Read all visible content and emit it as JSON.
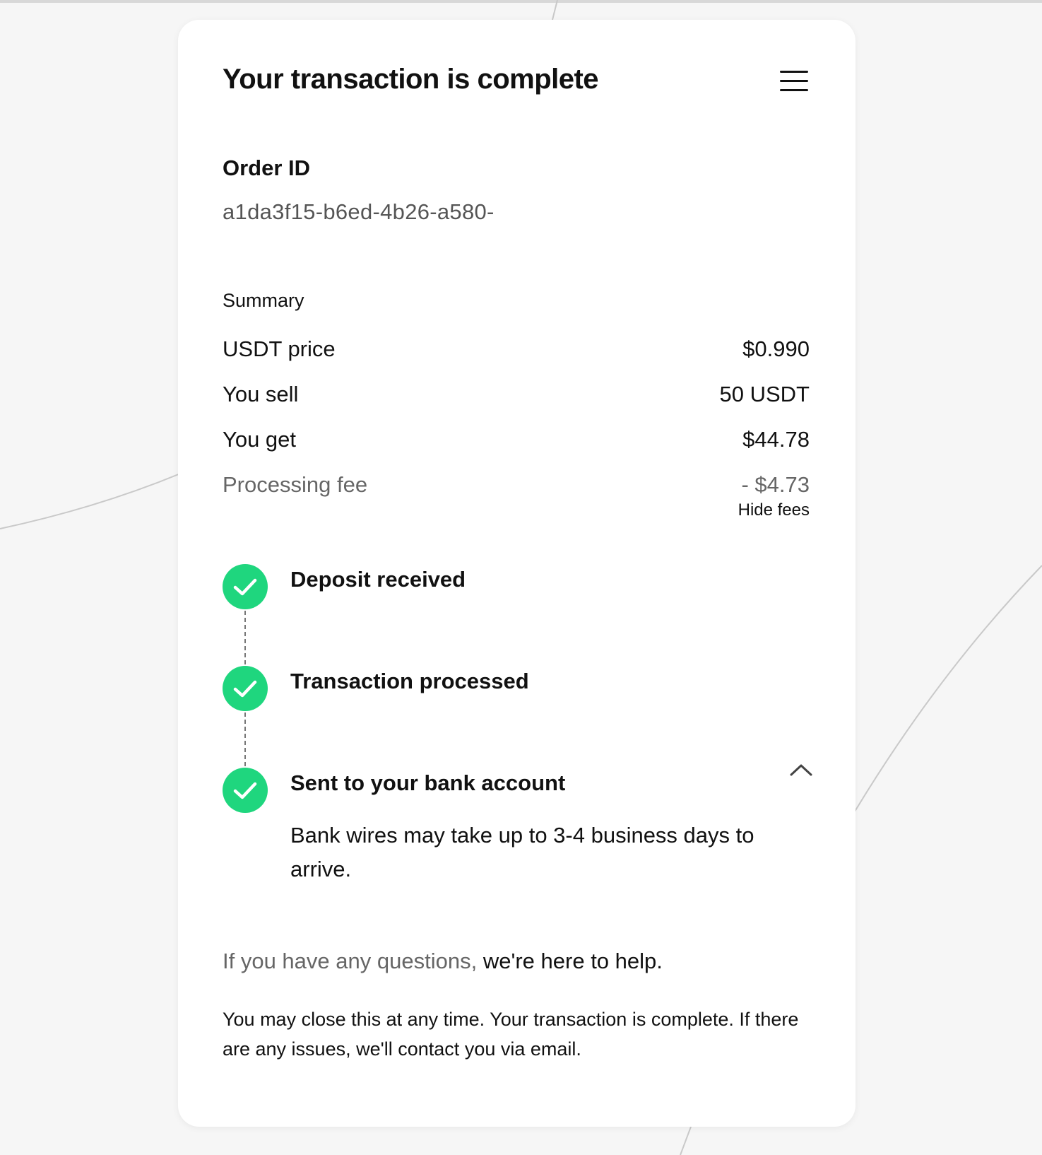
{
  "header": {
    "title": "Your transaction is complete",
    "menu_icon": "hamburger-menu-icon"
  },
  "order": {
    "label": "Order ID",
    "value": "a1da3f15-b6ed-4b26-a580-"
  },
  "summary": {
    "label": "Summary",
    "rows": [
      {
        "label": "USDT price",
        "value": "$0.990"
      },
      {
        "label": "You sell",
        "value": "50 USDT"
      },
      {
        "label": "You get",
        "value": "$44.78"
      },
      {
        "label": "Processing fee",
        "value": "- $4.73"
      }
    ],
    "hide_fees_label": "Hide fees"
  },
  "steps": [
    {
      "title": "Deposit received",
      "status": "complete",
      "icon": "check-circle-icon"
    },
    {
      "title": "Transaction processed",
      "status": "complete",
      "icon": "check-circle-icon"
    },
    {
      "title": "Sent to your bank account",
      "status": "complete",
      "icon": "check-circle-icon",
      "description": "Bank wires may take up to 3-4 business days to arrive.",
      "expanded": true
    }
  ],
  "footer": {
    "help_prefix": "If you have any questions,",
    "help_link": "we're here to help.",
    "closing": "You may close this at any time. Your transaction is complete. If there are any issues, we'll contact you via email."
  },
  "colors": {
    "success": "#1fd67e",
    "text": "#111111",
    "muted": "#666666",
    "background": "#f6f6f6",
    "card": "#ffffff"
  }
}
